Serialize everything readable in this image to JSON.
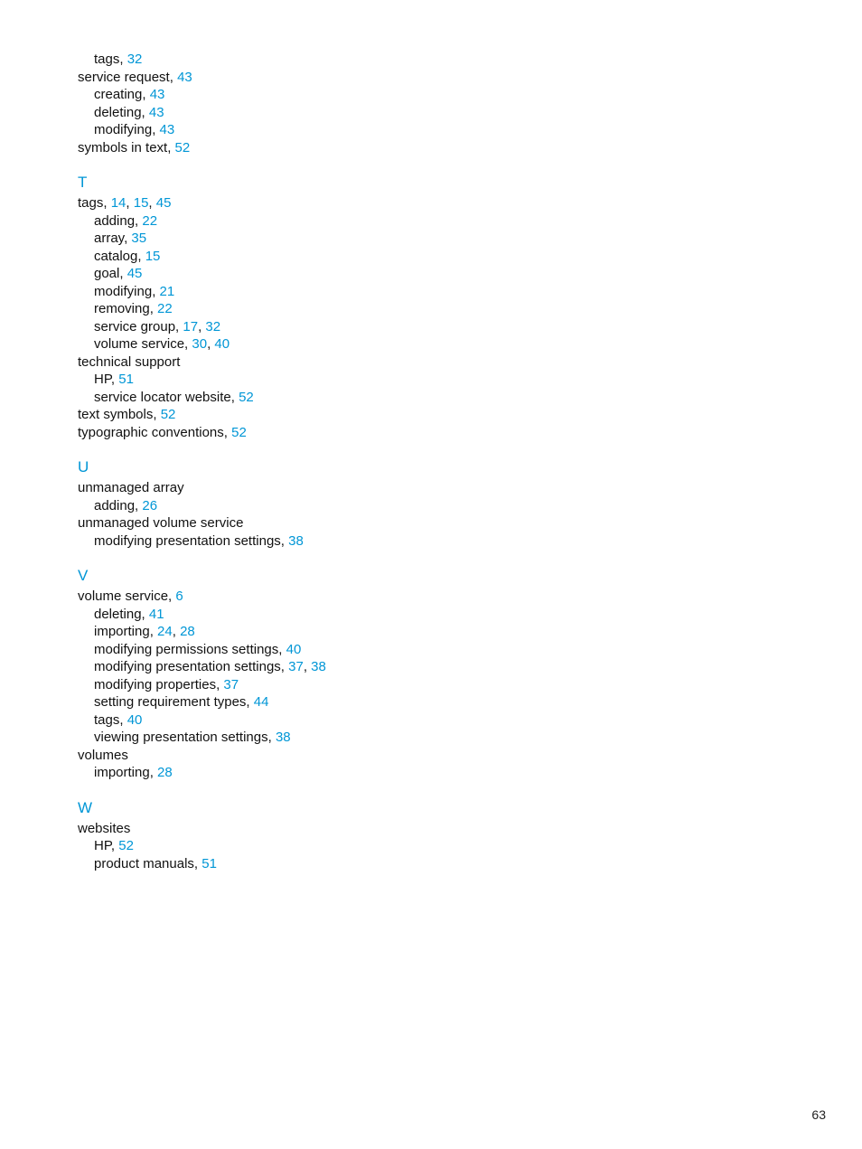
{
  "page_number": "63",
  "pre_lines": [
    {
      "level": 2,
      "parts": [
        {
          "t": "text",
          "v": "tags"
        },
        {
          "t": "sep",
          "v": ", "
        },
        {
          "t": "page",
          "v": "32"
        }
      ]
    },
    {
      "level": 1,
      "parts": [
        {
          "t": "text",
          "v": "service request"
        },
        {
          "t": "sep",
          "v": ", "
        },
        {
          "t": "page",
          "v": "43"
        }
      ]
    },
    {
      "level": 2,
      "parts": [
        {
          "t": "text",
          "v": "creating"
        },
        {
          "t": "sep",
          "v": ", "
        },
        {
          "t": "page",
          "v": "43"
        }
      ]
    },
    {
      "level": 2,
      "parts": [
        {
          "t": "text",
          "v": "deleting"
        },
        {
          "t": "sep",
          "v": ", "
        },
        {
          "t": "page",
          "v": "43"
        }
      ]
    },
    {
      "level": 2,
      "parts": [
        {
          "t": "text",
          "v": "modifying"
        },
        {
          "t": "sep",
          "v": ", "
        },
        {
          "t": "page",
          "v": "43"
        }
      ]
    },
    {
      "level": 1,
      "parts": [
        {
          "t": "text",
          "v": "symbols in text"
        },
        {
          "t": "sep",
          "v": ", "
        },
        {
          "t": "page",
          "v": "52"
        }
      ]
    }
  ],
  "sections": [
    {
      "heading": "T",
      "lines": [
        {
          "level": 1,
          "parts": [
            {
              "t": "text",
              "v": "tags"
            },
            {
              "t": "sep",
              "v": ", "
            },
            {
              "t": "page",
              "v": "14"
            },
            {
              "t": "sep",
              "v": ", "
            },
            {
              "t": "page",
              "v": "15"
            },
            {
              "t": "sep",
              "v": ", "
            },
            {
              "t": "page",
              "v": "45"
            }
          ]
        },
        {
          "level": 2,
          "parts": [
            {
              "t": "text",
              "v": "adding"
            },
            {
              "t": "sep",
              "v": ", "
            },
            {
              "t": "page",
              "v": "22"
            }
          ]
        },
        {
          "level": 2,
          "parts": [
            {
              "t": "text",
              "v": "array"
            },
            {
              "t": "sep",
              "v": ", "
            },
            {
              "t": "page",
              "v": "35"
            }
          ]
        },
        {
          "level": 2,
          "parts": [
            {
              "t": "text",
              "v": "catalog"
            },
            {
              "t": "sep",
              "v": ", "
            },
            {
              "t": "page",
              "v": "15"
            }
          ]
        },
        {
          "level": 2,
          "parts": [
            {
              "t": "text",
              "v": "goal"
            },
            {
              "t": "sep",
              "v": ", "
            },
            {
              "t": "page",
              "v": "45"
            }
          ]
        },
        {
          "level": 2,
          "parts": [
            {
              "t": "text",
              "v": "modifying"
            },
            {
              "t": "sep",
              "v": ", "
            },
            {
              "t": "page",
              "v": "21"
            }
          ]
        },
        {
          "level": 2,
          "parts": [
            {
              "t": "text",
              "v": "removing"
            },
            {
              "t": "sep",
              "v": ", "
            },
            {
              "t": "page",
              "v": "22"
            }
          ]
        },
        {
          "level": 2,
          "parts": [
            {
              "t": "text",
              "v": "service group"
            },
            {
              "t": "sep",
              "v": ", "
            },
            {
              "t": "page",
              "v": "17"
            },
            {
              "t": "sep",
              "v": ", "
            },
            {
              "t": "page",
              "v": "32"
            }
          ]
        },
        {
          "level": 2,
          "parts": [
            {
              "t": "text",
              "v": "volume service"
            },
            {
              "t": "sep",
              "v": ", "
            },
            {
              "t": "page",
              "v": "30"
            },
            {
              "t": "sep",
              "v": ", "
            },
            {
              "t": "page",
              "v": "40"
            }
          ]
        },
        {
          "level": 1,
          "parts": [
            {
              "t": "text",
              "v": "technical support"
            }
          ]
        },
        {
          "level": 2,
          "parts": [
            {
              "t": "text",
              "v": "HP"
            },
            {
              "t": "sep",
              "v": ", "
            },
            {
              "t": "page",
              "v": "51"
            }
          ]
        },
        {
          "level": 2,
          "parts": [
            {
              "t": "text",
              "v": "service locator website"
            },
            {
              "t": "sep",
              "v": ", "
            },
            {
              "t": "page",
              "v": "52"
            }
          ]
        },
        {
          "level": 1,
          "parts": [
            {
              "t": "text",
              "v": "text symbols"
            },
            {
              "t": "sep",
              "v": ", "
            },
            {
              "t": "page",
              "v": "52"
            }
          ]
        },
        {
          "level": 1,
          "parts": [
            {
              "t": "text",
              "v": "typographic conventions"
            },
            {
              "t": "sep",
              "v": ", "
            },
            {
              "t": "page",
              "v": "52"
            }
          ]
        }
      ]
    },
    {
      "heading": "U",
      "lines": [
        {
          "level": 1,
          "parts": [
            {
              "t": "text",
              "v": "unmanaged array"
            }
          ]
        },
        {
          "level": 2,
          "parts": [
            {
              "t": "text",
              "v": "adding"
            },
            {
              "t": "sep",
              "v": ", "
            },
            {
              "t": "page",
              "v": "26"
            }
          ]
        },
        {
          "level": 1,
          "parts": [
            {
              "t": "text",
              "v": "unmanaged volume service"
            }
          ]
        },
        {
          "level": 2,
          "parts": [
            {
              "t": "text",
              "v": "modifying presentation settings"
            },
            {
              "t": "sep",
              "v": ", "
            },
            {
              "t": "page",
              "v": "38"
            }
          ]
        }
      ]
    },
    {
      "heading": "V",
      "lines": [
        {
          "level": 1,
          "parts": [
            {
              "t": "text",
              "v": "volume service"
            },
            {
              "t": "sep",
              "v": ", "
            },
            {
              "t": "page",
              "v": "6"
            }
          ]
        },
        {
          "level": 2,
          "parts": [
            {
              "t": "text",
              "v": "deleting"
            },
            {
              "t": "sep",
              "v": ", "
            },
            {
              "t": "page",
              "v": "41"
            }
          ]
        },
        {
          "level": 2,
          "parts": [
            {
              "t": "text",
              "v": "importing"
            },
            {
              "t": "sep",
              "v": ", "
            },
            {
              "t": "page",
              "v": "24"
            },
            {
              "t": "sep",
              "v": ", "
            },
            {
              "t": "page",
              "v": "28"
            }
          ]
        },
        {
          "level": 2,
          "parts": [
            {
              "t": "text",
              "v": "modifying permissions settings"
            },
            {
              "t": "sep",
              "v": ", "
            },
            {
              "t": "page",
              "v": "40"
            }
          ]
        },
        {
          "level": 2,
          "parts": [
            {
              "t": "text",
              "v": "modifying presentation settings"
            },
            {
              "t": "sep",
              "v": ", "
            },
            {
              "t": "page",
              "v": "37"
            },
            {
              "t": "sep",
              "v": ", "
            },
            {
              "t": "page",
              "v": "38"
            }
          ]
        },
        {
          "level": 2,
          "parts": [
            {
              "t": "text",
              "v": "modifying properties"
            },
            {
              "t": "sep",
              "v": ", "
            },
            {
              "t": "page",
              "v": "37"
            }
          ]
        },
        {
          "level": 2,
          "parts": [
            {
              "t": "text",
              "v": "setting requirement types"
            },
            {
              "t": "sep",
              "v": ", "
            },
            {
              "t": "page",
              "v": "44"
            }
          ]
        },
        {
          "level": 2,
          "parts": [
            {
              "t": "text",
              "v": "tags"
            },
            {
              "t": "sep",
              "v": ", "
            },
            {
              "t": "page",
              "v": "40"
            }
          ]
        },
        {
          "level": 2,
          "parts": [
            {
              "t": "text",
              "v": "viewing presentation settings"
            },
            {
              "t": "sep",
              "v": ", "
            },
            {
              "t": "page",
              "v": "38"
            }
          ]
        },
        {
          "level": 1,
          "parts": [
            {
              "t": "text",
              "v": "volumes"
            }
          ]
        },
        {
          "level": 2,
          "parts": [
            {
              "t": "text",
              "v": "importing"
            },
            {
              "t": "sep",
              "v": ", "
            },
            {
              "t": "page",
              "v": "28"
            }
          ]
        }
      ]
    },
    {
      "heading": "W",
      "lines": [
        {
          "level": 1,
          "parts": [
            {
              "t": "text",
              "v": "websites"
            }
          ]
        },
        {
          "level": 2,
          "parts": [
            {
              "t": "text",
              "v": "HP"
            },
            {
              "t": "sep",
              "v": ", "
            },
            {
              "t": "page",
              "v": "52"
            }
          ]
        },
        {
          "level": 2,
          "parts": [
            {
              "t": "text",
              "v": "product manuals"
            },
            {
              "t": "sep",
              "v": ", "
            },
            {
              "t": "page",
              "v": "51"
            }
          ]
        }
      ]
    }
  ]
}
